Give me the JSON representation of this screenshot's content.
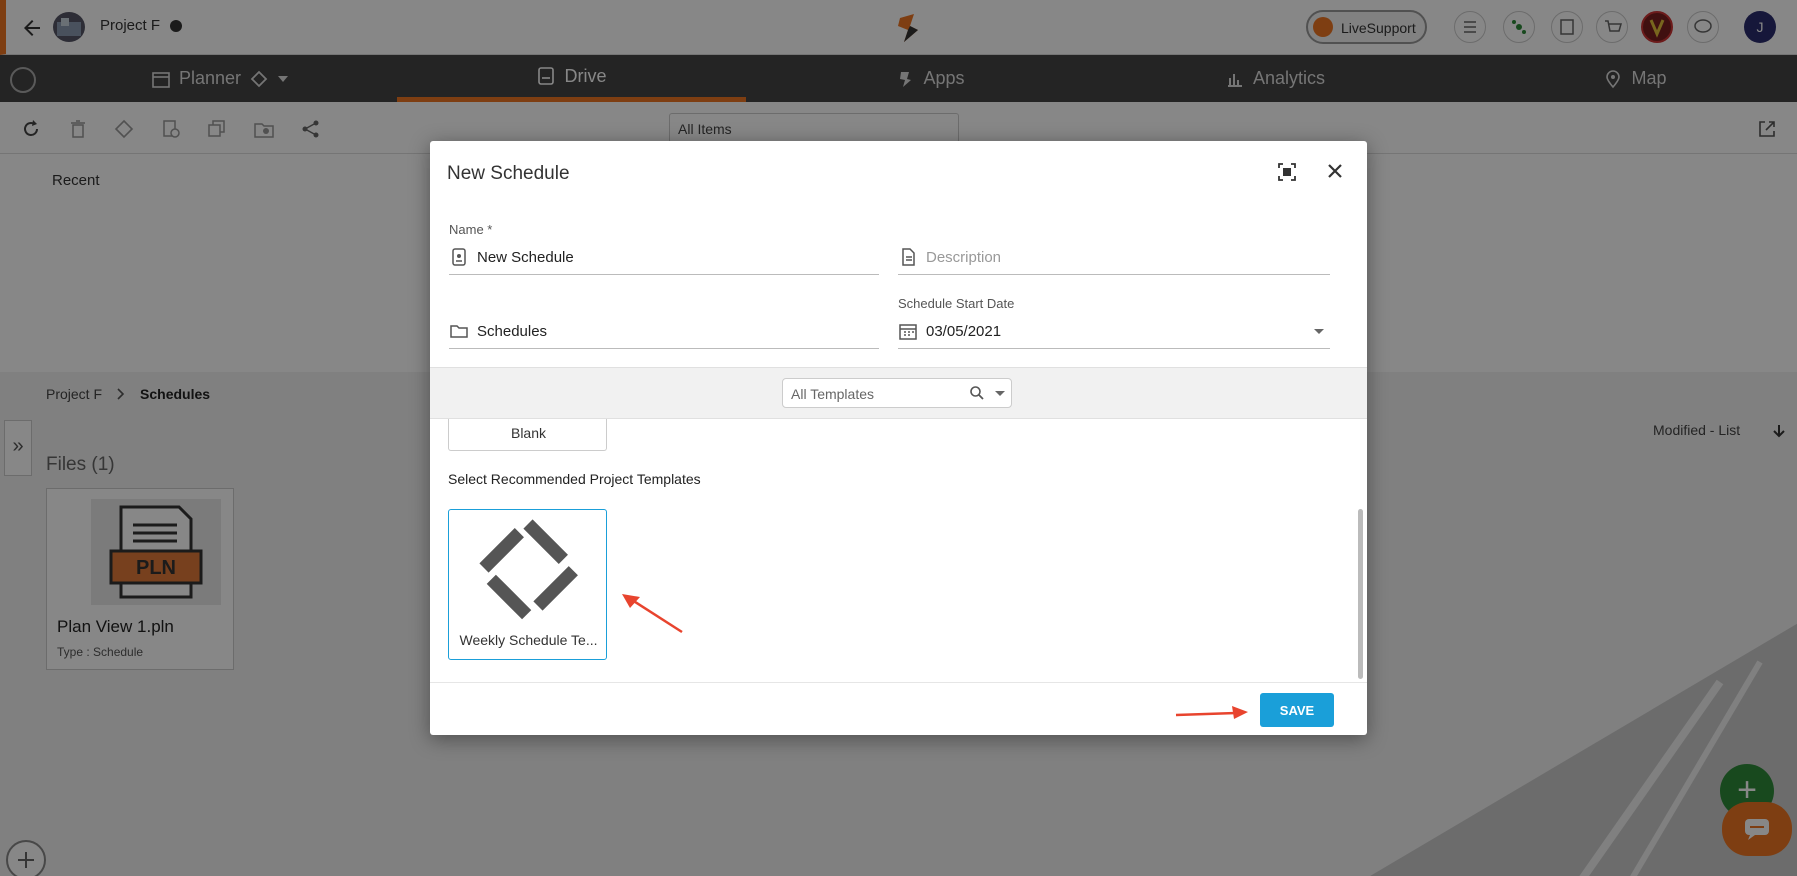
{
  "topbar": {
    "project_name": "Project F",
    "live_support": "LiveSupport",
    "user_initial": "J"
  },
  "nav": {
    "tabs": [
      {
        "label": "Planner",
        "icon": "calendar-icon"
      },
      {
        "label": "Drive",
        "icon": "drive-icon",
        "active": true
      },
      {
        "label": "Apps",
        "icon": "apps-icon"
      },
      {
        "label": "Analytics",
        "icon": "analytics-icon"
      },
      {
        "label": "Map",
        "icon": "map-pin-icon"
      }
    ]
  },
  "toolbar": {
    "filter_value": "All Items"
  },
  "recent": {
    "label": "Recent"
  },
  "breadcrumb": {
    "root": "Project F",
    "current": "Schedules"
  },
  "files": {
    "heading": "Files (1)",
    "sort_label": "Modified - List",
    "items": [
      {
        "name": "Plan View 1.pln",
        "type": "Type : Schedule",
        "thumb_text": "PLN"
      }
    ]
  },
  "dialog": {
    "title": "New Schedule",
    "name_label": "Name *",
    "name_value": "New Schedule",
    "description_placeholder": "Description",
    "folder_value": "Schedules",
    "start_date_label": "Schedule Start Date",
    "start_date_value": "03/05/2021",
    "template_filter": "All Templates",
    "blank_label": "Blank",
    "recommended_title": "Select Recommended Project Templates",
    "template_label": "Weekly Schedule Te...",
    "save_label": "SAVE"
  },
  "colors": {
    "accent_orange": "#ee7623",
    "primary_blue": "#1a9fd9",
    "nav_bg": "#444444"
  }
}
